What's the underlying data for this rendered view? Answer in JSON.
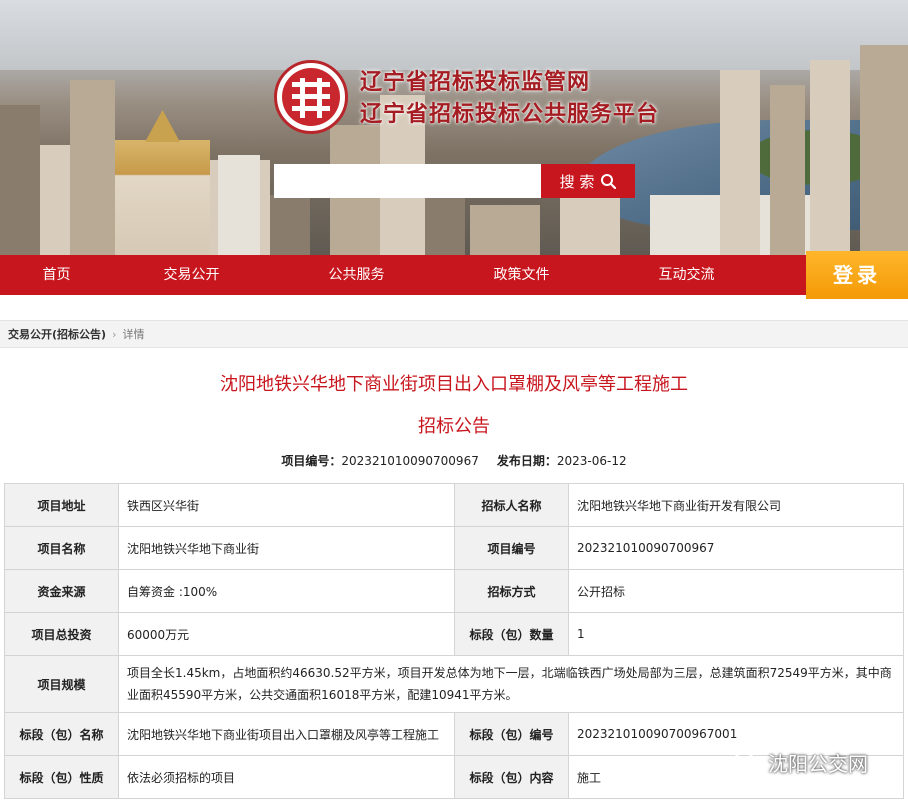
{
  "header": {
    "site_title": "辽宁省招标投标监管网",
    "site_subtitle": "辽宁省招标投标公共服务平台",
    "search_placeholder": "",
    "search_button": "搜 索",
    "login_button": "登录"
  },
  "nav": {
    "items": [
      {
        "label": "首页"
      },
      {
        "label": "交易公开"
      },
      {
        "label": "公共服务"
      },
      {
        "label": "政策文件"
      },
      {
        "label": "互动交流"
      }
    ]
  },
  "breadcrumb": {
    "parent": "交易公开(招标公告)",
    "separator": "›",
    "current": "详情"
  },
  "document": {
    "title": "沈阳地铁兴华地下商业街项目出入口罩棚及风亭等工程施工",
    "subtitle": "招标公告",
    "project_no_label": "项目编号：",
    "project_no": "202321010090700967",
    "publish_date_label": "发布日期：",
    "publish_date": "2023-06-12"
  },
  "table": {
    "rows": [
      {
        "l1": "项目地址",
        "v1": "铁西区兴华街",
        "l2": "招标人名称",
        "v2": "沈阳地铁兴华地下商业街开发有限公司"
      },
      {
        "l1": "项目名称",
        "v1": "沈阳地铁兴华地下商业街",
        "l2": "项目编号",
        "v2": "202321010090700967"
      },
      {
        "l1": "资金来源",
        "v1": "自筹资金 :100%",
        "l2": "招标方式",
        "v2": "公开招标"
      },
      {
        "l1": "项目总投资",
        "v1": "60000万元",
        "l2": "标段（包）数量",
        "v2": "1"
      },
      {
        "l1": "项目规模",
        "v1": "项目全长1.45km，占地面积约46630.52平方米，项目开发总体为地下一层，北端临铁西广场处局部为三层，总建筑面积72549平方米，其中商业面积45590平方米，公共交通面积16018平方米，配建10941平方米。"
      },
      {
        "l1": "标段（包）名称",
        "v1": "沈阳地铁兴华地下商业街项目出入口罩棚及风亭等工程施工",
        "l2": "标段（包）编号",
        "v2": "202321010090700967001"
      },
      {
        "l1": "标段（包）性质",
        "v1": "依法必须招标的项目",
        "l2": "标段（包）内容",
        "v2": "施工"
      }
    ]
  },
  "watermark": {
    "text": "沈阳公交网",
    "icon": "wechat-icon"
  },
  "colors": {
    "brand_red": "#c8161e",
    "login_orange": "#f5a00e",
    "label_bg": "#f1f1f1"
  }
}
